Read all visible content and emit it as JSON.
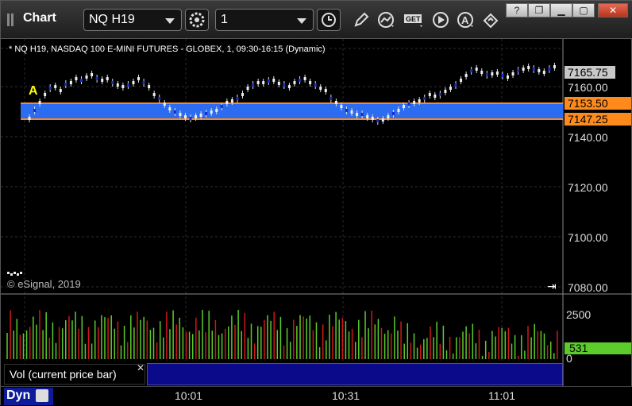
{
  "window": {
    "title": "Chart",
    "symbol": "NQ H19",
    "interval": "1"
  },
  "chart": {
    "info_line": "* NQ H19, NASDAQ 100 E-MINI FUTURES - GLOBEX, 1, 09:30-16:15 (Dynamic)",
    "copyright": "© eSignal, 2019",
    "marker": "A",
    "price_axis": [
      "7160.00",
      "7140.00",
      "7120.00",
      "7100.00",
      "7080.00"
    ],
    "price_tags": {
      "last": "7165.75",
      "upper_band": "7153.50",
      "lower_band": "7147.25"
    },
    "volume_axis": [
      "2500",
      "0"
    ],
    "volume_tag": "531",
    "volume_study": "Vol (current price bar)",
    "time_axis": [
      "10:01",
      "10:31",
      "11:01"
    ],
    "mode_button": "Dyn",
    "colors": {
      "band": "#2c6cf0",
      "band_line": "#ff8a1c",
      "up_volume": "#5bcc2b",
      "down_volume": "#d01818",
      "last_tag": "#c8c8c8",
      "band_tag": "#ff8a1c"
    }
  },
  "toolbar_icons": [
    "settings-icon",
    "clock-icon",
    "pencil-icon",
    "study-icon",
    "get-icon",
    "play-icon",
    "alert-icon",
    "link-icon"
  ],
  "window_buttons": [
    "help-icon",
    "restore-icon",
    "maximize-icon",
    "close-icon"
  ]
}
